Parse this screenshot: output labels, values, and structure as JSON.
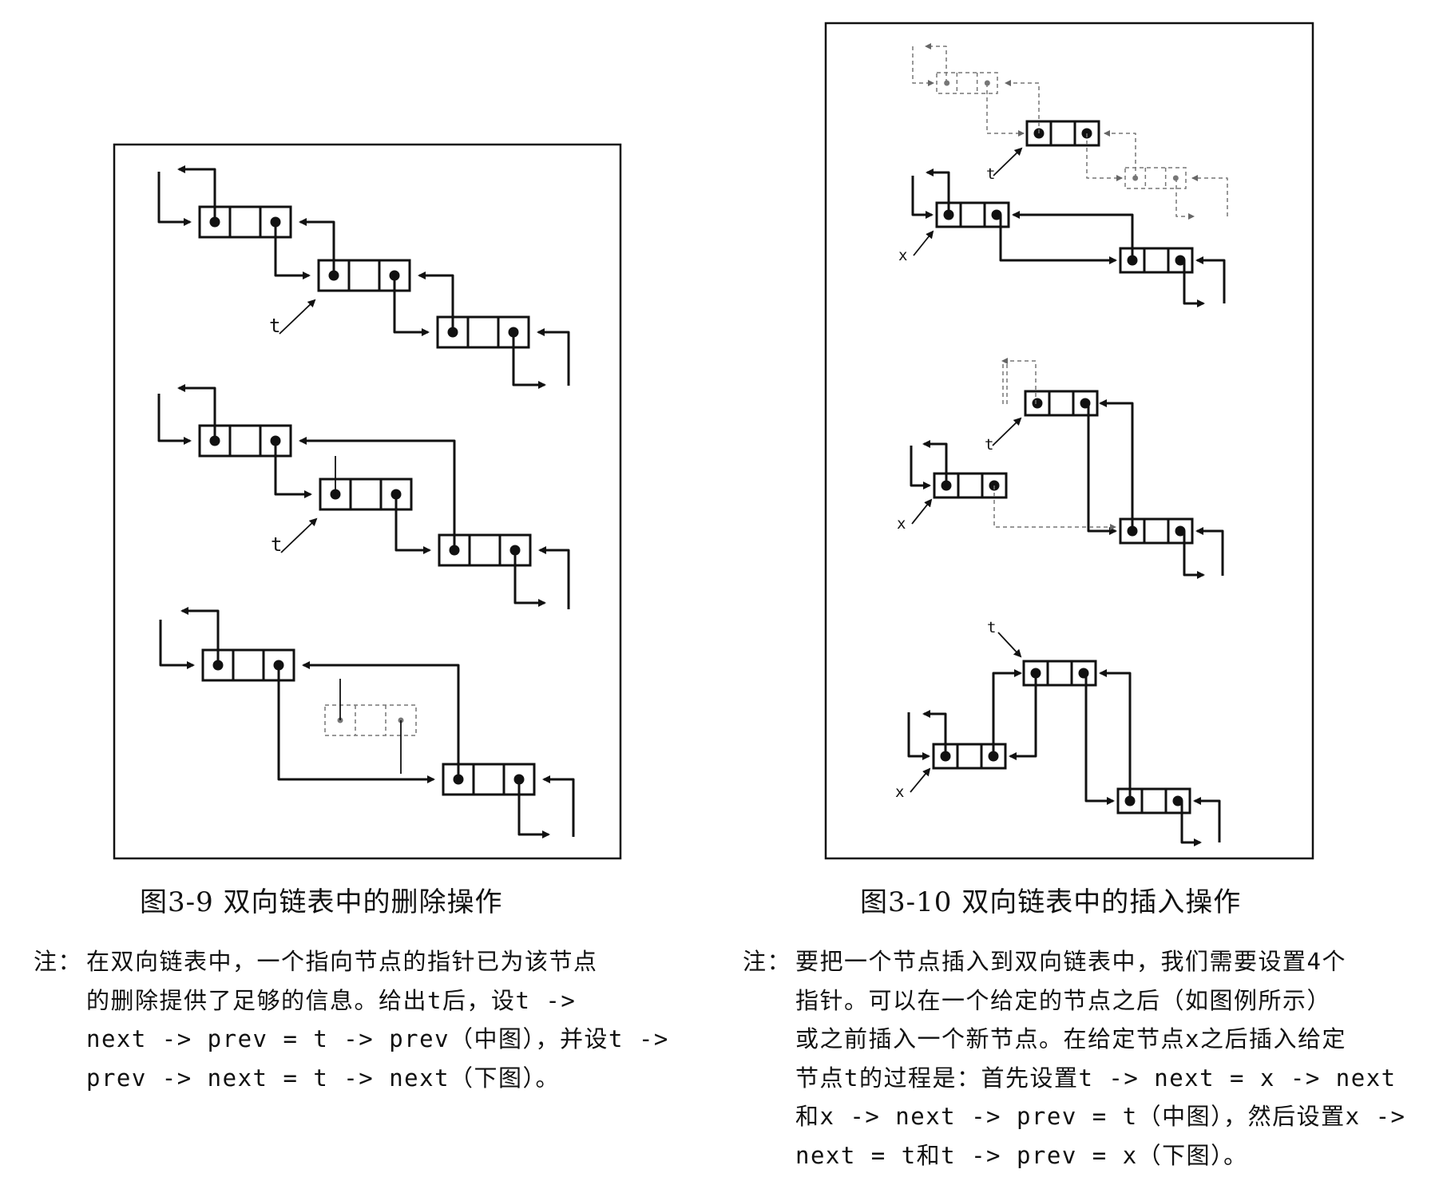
{
  "figure_left": {
    "caption": "图3-9  双向链表中的删除操作",
    "note_prefix": "注：",
    "note_text": "在双向链表中，一个指向节点的指针已为该节点\n的删除提供了足够的信息。给出t后，设t ->\nnext -> prev = t -> prev（中图），并设t ->\nprev -> next = t -> next（下图）。",
    "pointer_label": "t"
  },
  "figure_right": {
    "caption": "图3-10  双向链表中的插入操作",
    "note_prefix": "注：",
    "note_text": "要把一个节点插入到双向链表中，我们需要设置4个\n指针。可以在一个给定的节点之后（如图例所示）\n或之前插入一个新节点。在给定节点x之后插入给定\n节点t的过程是：首先设置t -> next = x -> next\n和x -> next -> prev = t（中图），然后设置x ->\nnext = t和t -> prev = x（下图）。",
    "pointer_label_t": "t",
    "pointer_label_x": "x"
  }
}
